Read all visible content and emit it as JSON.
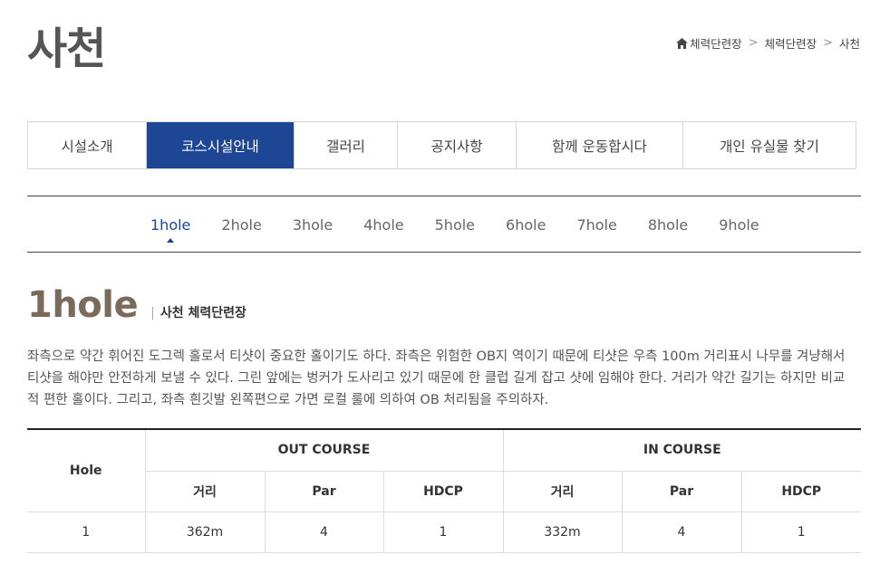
{
  "page": {
    "title": "사천"
  },
  "breadcrumb": {
    "items": [
      "체력단련장",
      "체력단련장",
      "사천"
    ]
  },
  "tabs": [
    {
      "label": "시설소개",
      "active": false
    },
    {
      "label": "코스시설안내",
      "active": true
    },
    {
      "label": "갤러리",
      "active": false
    },
    {
      "label": "공지사항",
      "active": false
    },
    {
      "label": "함께 운동합시다",
      "active": false
    },
    {
      "label": "개인 유실물 찾기",
      "active": false
    }
  ],
  "holes": [
    "1hole",
    "2hole",
    "3hole",
    "4hole",
    "5hole",
    "6hole",
    "7hole",
    "8hole",
    "9hole"
  ],
  "hole_detail": {
    "title": "1hole",
    "subtitle": "사천 체력단련장",
    "description": "좌측으로 약간 휘어진 도그렉 홀로서 티샷이 중요한 홀이기도 하다. 좌측은 위험한 OB지 역이기 때문에 티샷은 우측 100m 거리표시 나무를 겨냥해서 티샷을 해야만 안전하게 보낼 수 있다. 그린 앞에는 벙커가 도사리고 있기 때문에 한 클럽 길게 잡고 샷에 임해야 한다. 거리가 약간 길기는 하지만 비교적 편한 홀이다. 그리고, 좌측 흰깃발 왼쪽편으로 가면 로컬 룰에 의하여 OB 처리됨을 주의하자."
  },
  "table": {
    "hole_header": "Hole",
    "out_course": "OUT COURSE",
    "in_course": "IN COURSE",
    "columns": [
      "거리",
      "Par",
      "HDCP",
      "거리",
      "Par",
      "HDCP"
    ],
    "row": [
      "1",
      "362m",
      "4",
      "1",
      "332m",
      "4",
      "1"
    ]
  },
  "colors": {
    "accent": "#1d4694",
    "hole_title": "#7a6a5a"
  }
}
